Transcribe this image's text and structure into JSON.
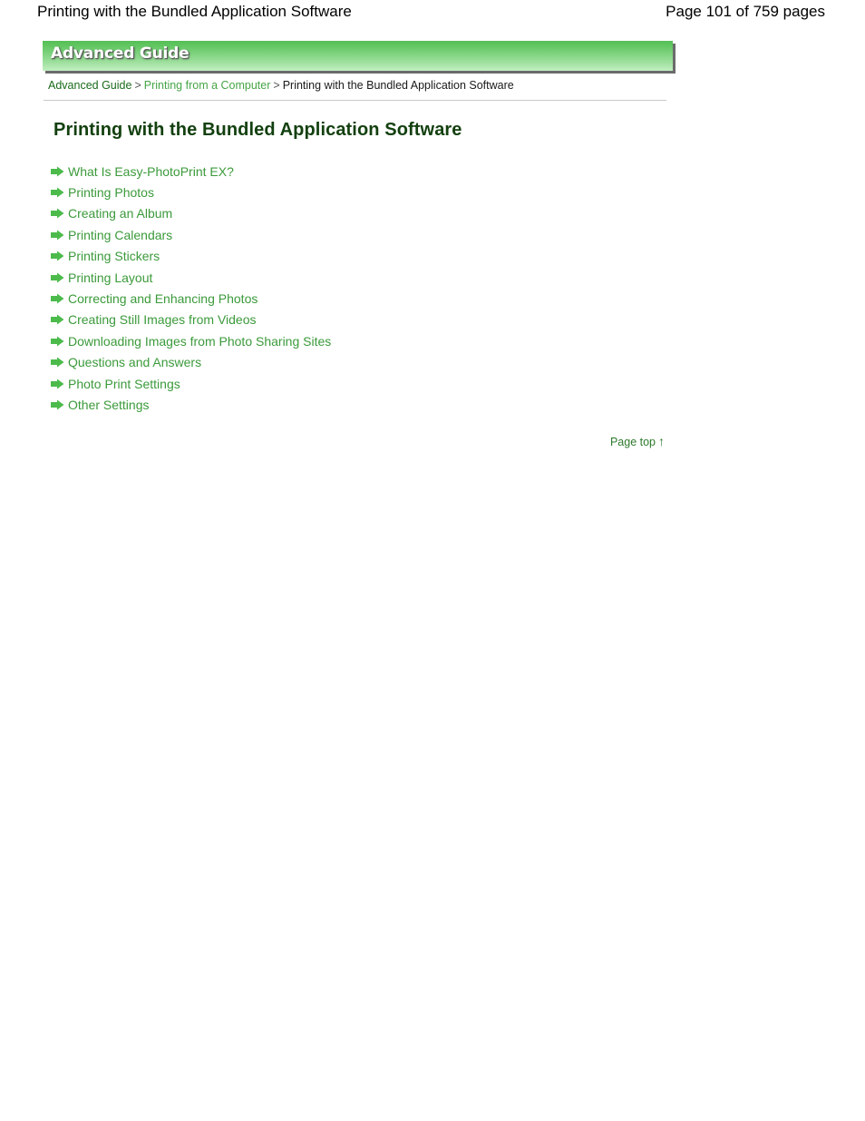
{
  "page_header": {
    "title": "Printing with the Bundled Application Software",
    "page_info": "Page 101 of 759 pages"
  },
  "banner": {
    "label": "Advanced Guide"
  },
  "breadcrumb": {
    "root": "Advanced Guide",
    "sep1": ">",
    "middle": "Printing from a Computer",
    "sep2": ">",
    "current": "Printing with the Bundled Application Software"
  },
  "main": {
    "title": "Printing with the Bundled Application Software",
    "links": [
      {
        "label": "What Is Easy-PhotoPrint EX?",
        "icon": "arrow-right-icon"
      },
      {
        "label": "Printing Photos",
        "icon": "arrow-right-icon"
      },
      {
        "label": "Creating an Album",
        "icon": "arrow-right-icon"
      },
      {
        "label": "Printing Calendars",
        "icon": "arrow-right-icon"
      },
      {
        "label": "Printing Stickers",
        "icon": "arrow-right-icon"
      },
      {
        "label": "Printing Layout",
        "icon": "arrow-right-icon"
      },
      {
        "label": "Correcting and Enhancing Photos",
        "icon": "arrow-right-icon"
      },
      {
        "label": "Creating Still Images from Videos",
        "icon": "arrow-right-icon"
      },
      {
        "label": "Downloading Images from Photo Sharing Sites",
        "icon": "arrow-right-icon"
      },
      {
        "label": "Questions and Answers",
        "icon": "arrow-right-icon"
      },
      {
        "label": "Photo Print Settings",
        "icon": "arrow-right-icon"
      },
      {
        "label": "Other Settings",
        "icon": "arrow-right-icon"
      }
    ]
  },
  "footer": {
    "page_top_label": "Page top",
    "page_top_icon": "arrow-up-icon",
    "page_top_glyph": "↑"
  },
  "colors": {
    "banner_green_top": "#55bf55",
    "banner_green_bottom": "#c2efc2",
    "link_green": "#3b9a3b",
    "title_green": "#13400f",
    "crumb_root_green": "#1b6b1b",
    "crumb_mid_green": "#46a546",
    "divider_gray": "#c8c8c8"
  }
}
